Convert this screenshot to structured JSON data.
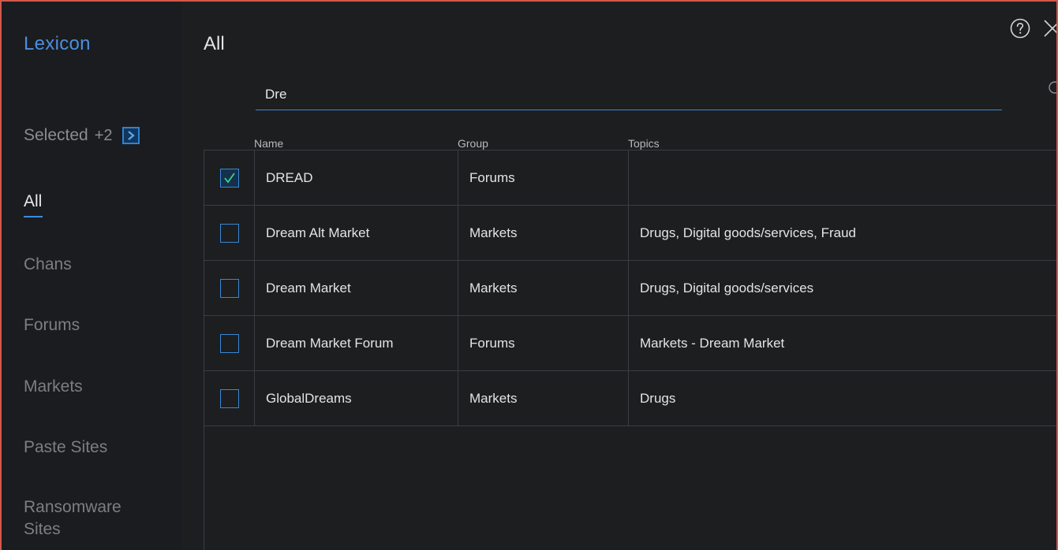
{
  "sidebar": {
    "app_title": "Lexicon",
    "selected_label": "Selected",
    "selected_count": "+2",
    "nav": [
      {
        "label": "All",
        "active": true
      },
      {
        "label": "Chans"
      },
      {
        "label": "Forums"
      },
      {
        "label": "Markets"
      },
      {
        "label": "Paste Sites"
      },
      {
        "label": "Ransomware Sites"
      }
    ]
  },
  "main": {
    "title": "All",
    "search": {
      "value": "Dre",
      "placeholder": ""
    },
    "columns": {
      "name": "Name",
      "group": "Group",
      "topics": "Topics"
    },
    "rows": [
      {
        "checked": true,
        "name": "DREAD",
        "group": "Forums",
        "topics": ""
      },
      {
        "checked": false,
        "name": "Dream Alt Market",
        "group": "Markets",
        "topics": "Drugs, Digital goods/services, Fraud"
      },
      {
        "checked": false,
        "name": "Dream Market",
        "group": "Markets",
        "topics": "Drugs, Digital goods/services"
      },
      {
        "checked": false,
        "name": "Dream Market Forum",
        "group": "Forums",
        "topics": "Markets - Dream Market"
      },
      {
        "checked": false,
        "name": "GlobalDreams",
        "group": "Markets",
        "topics": "Drugs"
      }
    ]
  },
  "icons": {
    "help": "help-circle-icon",
    "close": "close-icon",
    "search": "search-icon",
    "selected_arrow": "chevron-right-icon",
    "checkmark": "checkmark-icon"
  },
  "colors": {
    "accent": "#3a86d4",
    "brand_title": "#4a8fe0",
    "check_green": "#3fd08a",
    "background": "#1d1e20",
    "border": "#d2584a"
  }
}
